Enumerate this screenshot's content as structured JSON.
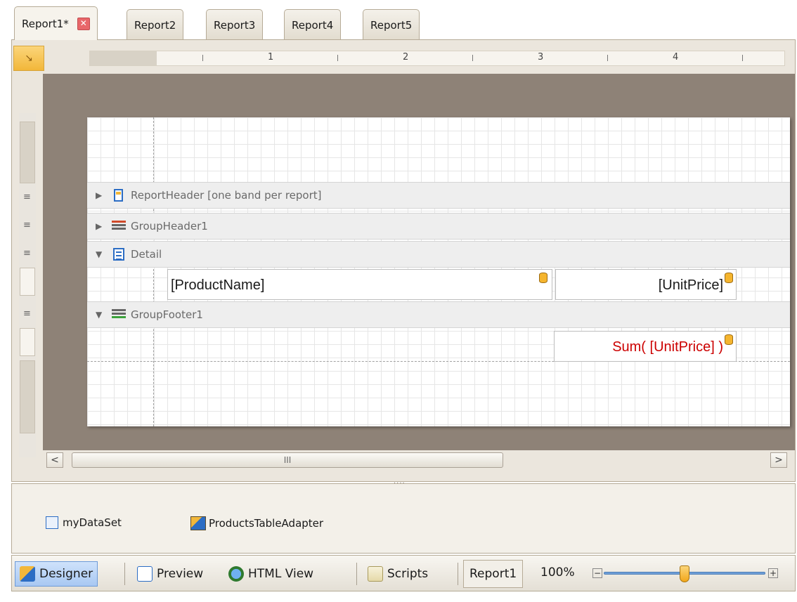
{
  "tabs": [
    {
      "label": "Report1*",
      "active": true,
      "closable": true
    },
    {
      "label": "Report2"
    },
    {
      "label": "Report3"
    },
    {
      "label": "Report4"
    },
    {
      "label": "Report5"
    }
  ],
  "ruler": {
    "numbers": [
      "1",
      "2",
      "3",
      "4"
    ]
  },
  "bands": {
    "report_header": "ReportHeader [one band per report]",
    "group_header": "GroupHeader1",
    "detail": "Detail",
    "group_footer": "GroupFooter1"
  },
  "cells": {
    "product_name": "[ProductName]",
    "unit_price": "[UnitPrice]",
    "sum_unit_price": "Sum( [UnitPrice] )",
    "sum_color": "#cc0000"
  },
  "scrollbar": {
    "left": "<",
    "right": ">",
    "thumb_grip": "III"
  },
  "tray": {
    "items": [
      {
        "label": "myDataSet",
        "icon": "dataset-icon"
      },
      {
        "label": "ProductsTableAdapter",
        "icon": "table-adapter-icon"
      }
    ]
  },
  "statusbar": {
    "designer": "Designer",
    "preview": "Preview",
    "html_view": "HTML View",
    "scripts": "Scripts",
    "report_name": "Report1",
    "zoom": "100%",
    "zoom_minus": "−",
    "zoom_plus": "+"
  }
}
